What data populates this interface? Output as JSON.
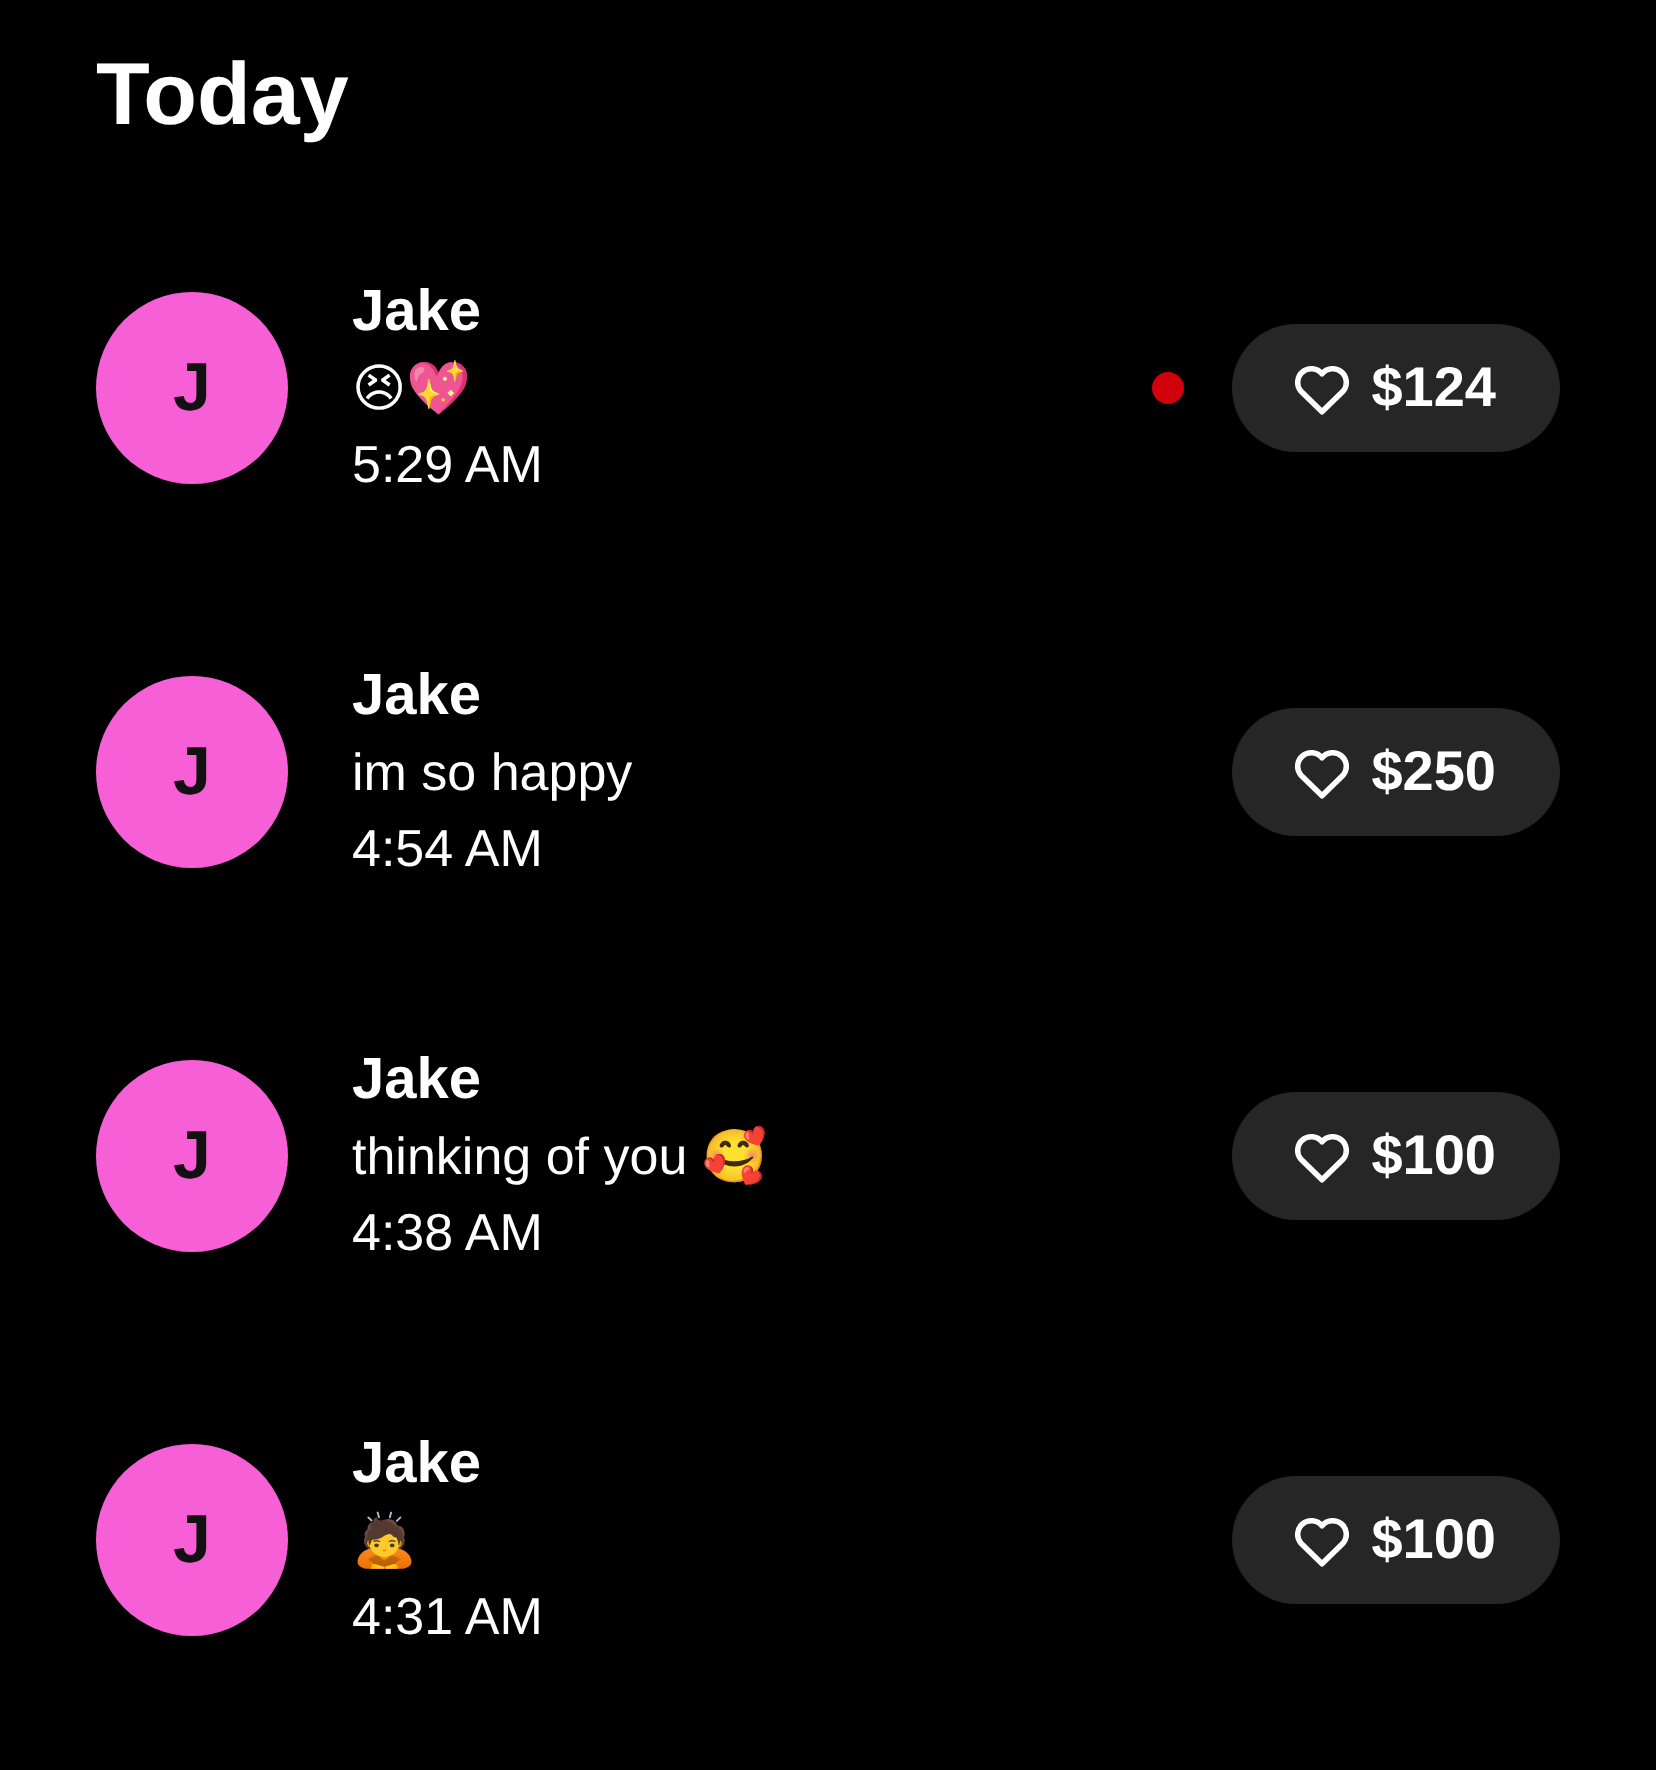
{
  "title": "Today",
  "messages": [
    {
      "initial": "J",
      "name": "Jake",
      "text": "😣💖",
      "time": "5:29 AM",
      "unread": true,
      "amount": "$124"
    },
    {
      "initial": "J",
      "name": "Jake",
      "text": "im so happy",
      "time": "4:54 AM",
      "unread": false,
      "amount": "$250"
    },
    {
      "initial": "J",
      "name": "Jake",
      "text": "thinking of you 🥰",
      "time": "4:38 AM",
      "unread": false,
      "amount": "$100"
    },
    {
      "initial": "J",
      "name": "Jake",
      "text": "🙇",
      "time": "4:31 AM",
      "unread": false,
      "amount": "$100"
    }
  ]
}
